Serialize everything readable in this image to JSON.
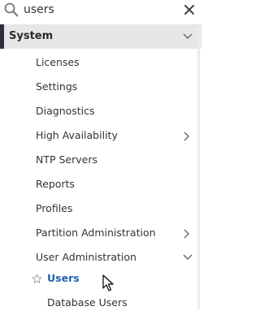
{
  "search": {
    "value": "users",
    "icon": "search-icon",
    "clear_icon": "close-icon"
  },
  "section": {
    "label": "System",
    "expanded": true
  },
  "items": [
    {
      "label": "Licenses"
    },
    {
      "label": "Settings"
    },
    {
      "label": "Diagnostics"
    },
    {
      "label": "High Availability",
      "chevron": "right"
    },
    {
      "label": "NTP Servers"
    },
    {
      "label": "Reports"
    },
    {
      "label": "Profiles"
    },
    {
      "label": "Partition Administration",
      "chevron": "right"
    },
    {
      "label": "User Administration",
      "chevron": "down"
    }
  ],
  "subitems": [
    {
      "label": "Users",
      "active": true,
      "favorite_icon": "star-outline-icon"
    },
    {
      "label": "Database Users"
    }
  ],
  "colors": {
    "accent_bar": "#2d2f3e",
    "header_bg": "#e7e7e9",
    "active_text": "#1f61b0"
  }
}
